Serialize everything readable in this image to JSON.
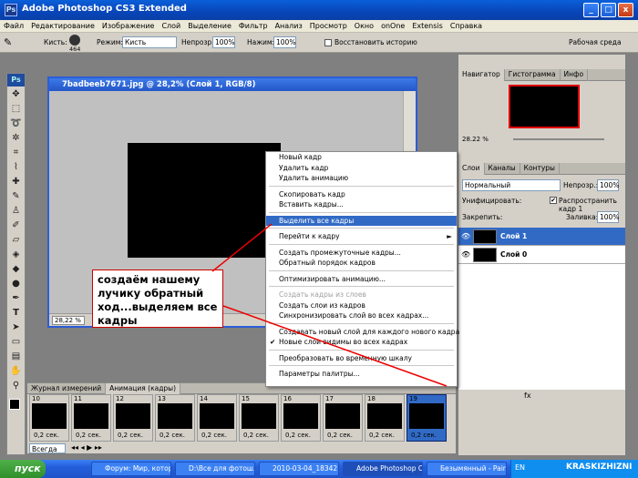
{
  "window": {
    "title": "Adobe Photoshop CS3 Extended",
    "app_icon": "Ps",
    "min": "_",
    "max": "□",
    "close": "x"
  },
  "menu": [
    "Файл",
    "Редактирование",
    "Изображение",
    "Слой",
    "Выделение",
    "Фильтр",
    "Анализ",
    "Просмотр",
    "Окно",
    "onOne",
    "Extensis",
    "Справка"
  ],
  "options": {
    "brush_label": "Кисть:",
    "brush_size": "464",
    "mode_label": "Режим:",
    "mode_value": "Кисть",
    "opacity_label": "Непрозр.:",
    "opacity_value": "100%",
    "pressure_label": "Нажим:",
    "pressure_value": "100%",
    "history_label": "Восстановить историю",
    "workspace": "Рабочая среда"
  },
  "toolbox": {
    "logo": "Ps"
  },
  "document": {
    "title": "7badbeeb7671.jpg @ 28,2% (Слой 1, RGB/8)",
    "zoom": "28,22 %"
  },
  "context_menu": {
    "items": [
      {
        "label": "Новый кадр",
        "state": "normal"
      },
      {
        "label": "Удалить кадр",
        "state": "normal"
      },
      {
        "label": "Удалить анимацию",
        "state": "normal"
      },
      {
        "sep": true
      },
      {
        "label": "Скопировать кадр",
        "state": "normal"
      },
      {
        "label": "Вставить кадры...",
        "state": "normal"
      },
      {
        "sep": true
      },
      {
        "label": "Выделить все кадры",
        "state": "highlighted"
      },
      {
        "sep": true
      },
      {
        "label": "Перейти к кадру",
        "state": "normal",
        "submenu": "►"
      },
      {
        "sep": true
      },
      {
        "label": "Создать промежуточные кадры...",
        "state": "normal"
      },
      {
        "label": "Обратный порядок кадров",
        "state": "normal"
      },
      {
        "sep": true
      },
      {
        "label": "Оптимизировать анимацию...",
        "state": "normal"
      },
      {
        "sep": true
      },
      {
        "label": "Создать кадры из слоев",
        "state": "disabled"
      },
      {
        "label": "Создать слои из кадров",
        "state": "normal"
      },
      {
        "label": "Синхронизировать слой во всех кадрах...",
        "state": "normal"
      },
      {
        "sep": true
      },
      {
        "label": "Создавать новый слой для каждого нового кадра",
        "state": "normal"
      },
      {
        "label": "Новые слои видимы во всех кадрах",
        "state": "normal",
        "check": "✔"
      },
      {
        "sep": true
      },
      {
        "label": "Преобразовать во временную шкалу",
        "state": "normal"
      },
      {
        "sep": true
      },
      {
        "label": "Параметры палитры...",
        "state": "normal"
      }
    ]
  },
  "annotation": "создаём нашему лучику обратный ход...выделяем все кадры",
  "navigator": {
    "tabs": [
      "Навигатор",
      "Гистограмма",
      "Инфо"
    ],
    "zoom": "28.22 %"
  },
  "layers": {
    "tabs": [
      "Слои",
      "Каналы",
      "Контуры"
    ],
    "blend_mode": "Нормальный",
    "opacity_label": "Непрозр.:",
    "opacity": "100%",
    "unify_label": "Унифицировать:",
    "propagate_label": "Распространить кадр 1",
    "lock_label": "Закрепить:",
    "fill_label": "Заливка:",
    "fill": "100%",
    "items": [
      {
        "name": "Слой 1",
        "selected": true
      },
      {
        "name": "Слой 0",
        "selected": false
      }
    ],
    "bottom_icons": "fx"
  },
  "animation": {
    "tabs": [
      "Журнал измерений",
      "Анимация (кадры)"
    ],
    "frames": [
      {
        "num": "10",
        "delay": "0,2 сек."
      },
      {
        "num": "11",
        "delay": "0,2 сек."
      },
      {
        "num": "12",
        "delay": "0,2 сек."
      },
      {
        "num": "13",
        "delay": "0,2 сек."
      },
      {
        "num": "14",
        "delay": "0,2 сек."
      },
      {
        "num": "15",
        "delay": "0,2 сек."
      },
      {
        "num": "16",
        "delay": "0,2 сек."
      },
      {
        "num": "17",
        "delay": "0,2 сек."
      },
      {
        "num": "18",
        "delay": "0,2 сек."
      },
      {
        "num": "19",
        "delay": "0,2 сек."
      }
    ],
    "loop": "Всегда"
  },
  "taskbar": {
    "start": "пуск",
    "tasks": [
      "Форум: Мир, котор...",
      "D:\\Все для фотош...",
      "2010-03-04_18342...",
      "Adobe Photoshop C...",
      "Безымянный - Paint"
    ],
    "lang": "EN",
    "watermark": "KRASKIZHIZNI"
  }
}
